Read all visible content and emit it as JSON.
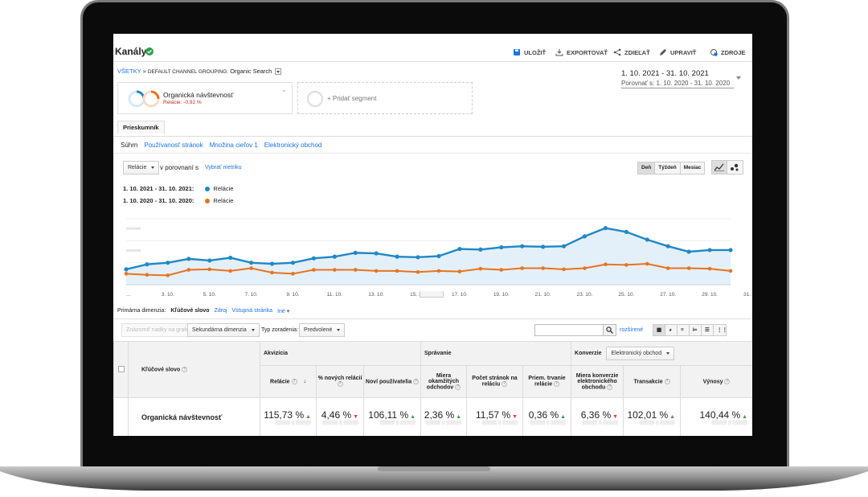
{
  "header": {
    "title": "Kanály",
    "buttons": {
      "save": "ULOŽIŤ",
      "export": "EXPORTOVAŤ",
      "share": "ZDIEĽAŤ",
      "edit": "UPRAVIŤ",
      "sources": "ZDROJE"
    }
  },
  "breadcrumb": {
    "all": "VŠETKY",
    "separator": "»",
    "grouping": "DEFAULT CHANNEL GROUPING:",
    "value": "Organic Search"
  },
  "segment": {
    "name": "Organická návštevnosť",
    "delta": "Relácie: -0,92 %",
    "add": "+ Pridať segment"
  },
  "date_range": {
    "current": "1. 10. 2021 - 31. 10. 2021",
    "compare": "Porovnať s:  1. 10. 2020 - 31. 10. 2020"
  },
  "tabs": {
    "explorer": "Prieskumník"
  },
  "subnav": {
    "summary": "Súhrn",
    "usage": "Používanosť stránok",
    "goals": "Množina cieľov 1",
    "ecommerce": "Elektronický obchod"
  },
  "chart_controls": {
    "metric": "Relácie",
    "vs": "v porovnaní s",
    "pick": "Vybrať metriku",
    "day": "Deň",
    "week": "Týždeň",
    "month": "Mesiac"
  },
  "chart_legend": {
    "current_range": "1. 10. 2021 - 31. 10. 2021:",
    "current_label": "Relácie",
    "prev_range": "1. 10. 2020 - 31. 10. 2020:",
    "prev_label": "Relácie"
  },
  "chart_data": {
    "type": "area",
    "x": [
      "1. 10.",
      "2. 10.",
      "3. 10.",
      "4. 10.",
      "5. 10.",
      "6. 10.",
      "7. 10.",
      "8. 10.",
      "9. 10.",
      "10. 10.",
      "11. 10.",
      "12. 10.",
      "13. 10.",
      "14. 10.",
      "15. 10.",
      "16. 10.",
      "17. 10.",
      "18. 10.",
      "19. 10.",
      "20. 10.",
      "21. 10.",
      "22. 10.",
      "23. 10.",
      "24. 10.",
      "25. 10.",
      "26. 10.",
      "27. 10.",
      "28. 10.",
      "29. 10.",
      "30. 10.",
      "31. 10."
    ],
    "tick_labels": [
      "...",
      "3. 10.",
      "5. 10.",
      "7. 10.",
      "9. 10.",
      "11. 10.",
      "13. 10.",
      "15. 10.",
      "17. 10.",
      "19. 10.",
      "21. 10.",
      "23. 10.",
      "25. 10.",
      "27. 10.",
      "29. 10.",
      "31. 10."
    ],
    "series": [
      {
        "name": "Relácie",
        "color": "#1f88c6",
        "values": [
          0.28,
          0.37,
          0.4,
          0.47,
          0.44,
          0.49,
          0.4,
          0.38,
          0.4,
          0.48,
          0.51,
          0.58,
          0.57,
          0.51,
          0.5,
          0.52,
          0.65,
          0.64,
          0.68,
          0.7,
          0.69,
          0.7,
          0.88,
          1.03,
          0.96,
          0.82,
          0.7,
          0.6,
          0.63,
          0.63
        ]
      },
      {
        "name": "Relácie",
        "color": "#e8731f",
        "values": [
          0.2,
          0.18,
          0.17,
          0.27,
          0.28,
          0.25,
          0.3,
          0.22,
          0.2,
          0.27,
          0.27,
          0.27,
          0.25,
          0.25,
          0.23,
          0.25,
          0.24,
          0.29,
          0.27,
          0.3,
          0.3,
          0.28,
          0.3,
          0.37,
          0.36,
          0.38,
          0.3,
          0.3,
          0.29,
          0.25
        ]
      }
    ],
    "ylim": [
      0,
      1.2
    ],
    "grid": true
  },
  "dimension": {
    "label": "Primárna dimenzia:",
    "keyword": "Kľúčové slovo",
    "source": "Zdroj",
    "landing": "Vstupná stránka",
    "other": "Iné"
  },
  "table_controls": {
    "plot": "Znázorniť riadky na grafe",
    "secondary": "Sekundárna dimenzia",
    "sort_label": "Typ zoradenia:",
    "sort_value": "Predvolené",
    "advanced": "rozšírené"
  },
  "table": {
    "dim_header": "Kľúčové slovo",
    "groups": {
      "acquisition": "Akvizícia",
      "behavior": "Správanie",
      "conversions": "Konverzie",
      "conv_select": "Elektronický obchod"
    },
    "columns": [
      "Relácie",
      "% nových relácií",
      "Noví používatelia",
      "Miera okamžitých odchodov",
      "Počet stránok na reláciu",
      "Priem. trvanie relácie",
      "Miera konverzie elektronického obchodu",
      "Transakcie",
      "Výnosy"
    ],
    "row": {
      "label": "Organická návštevnosť",
      "values": [
        "115,73 %",
        "4,46 %",
        "106,11 %",
        "2,36 %",
        "11,57 %",
        "0,36 %",
        "6,36 %",
        "102,01 %",
        "140,44 %"
      ],
      "trends": [
        "up",
        "down",
        "up",
        "up",
        "down",
        "up",
        "down",
        "up",
        "up"
      ]
    }
  }
}
